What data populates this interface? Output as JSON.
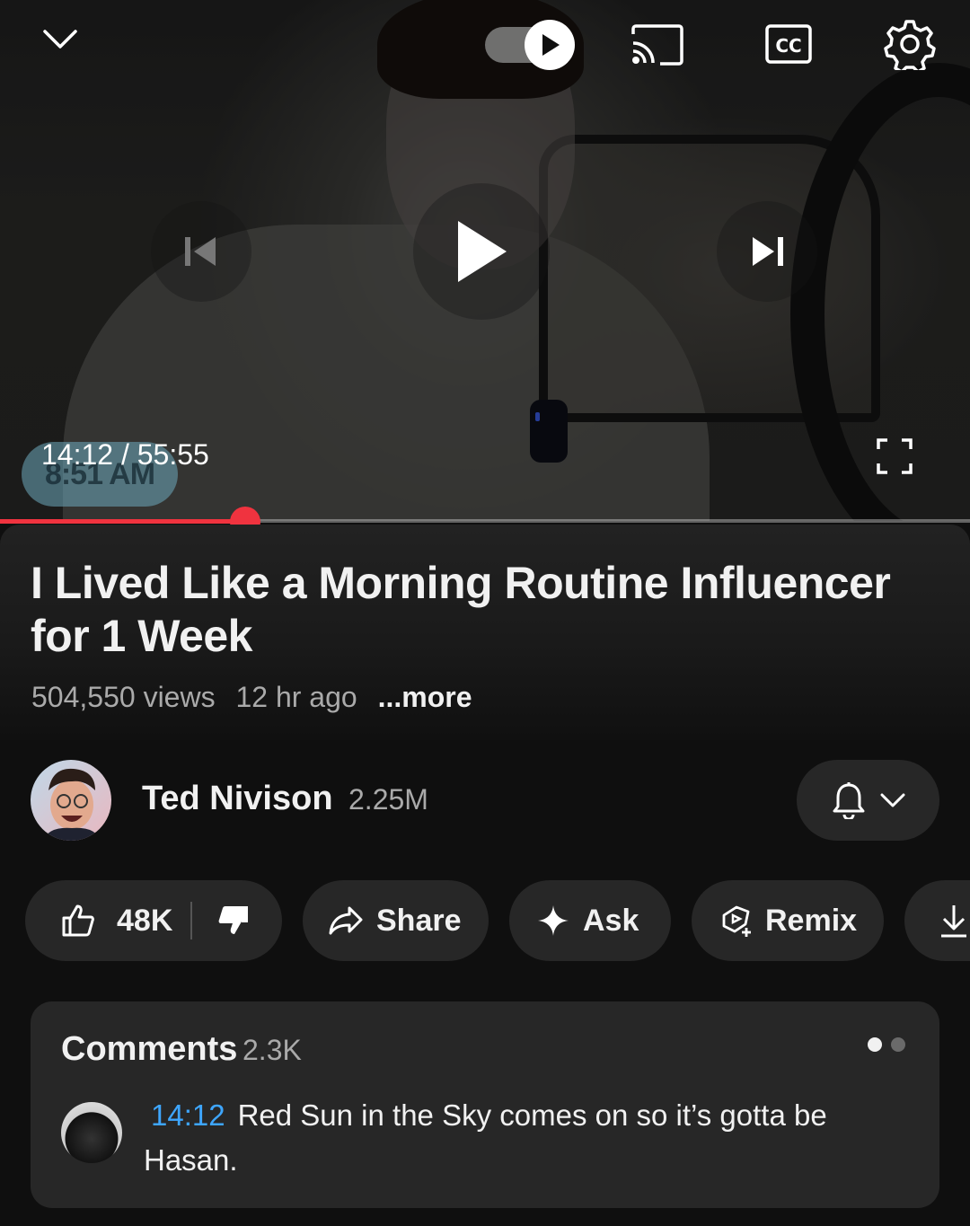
{
  "player": {
    "timestamp_overlay": "8:51 AM",
    "current_time": "14:12",
    "duration": "55:55",
    "time_separator": " / ",
    "progress": 0.253,
    "autoplay_on": true,
    "icons": [
      "chevron-down-icon",
      "autoplay-toggle",
      "cast-icon",
      "cc-icon",
      "settings-icon",
      "previous-icon",
      "play-icon",
      "next-icon",
      "fullscreen-icon"
    ]
  },
  "video": {
    "title": "I Lived Like a Morning Routine Influencer for 1 Week",
    "views": "504,550 views",
    "age": "12 hr ago",
    "more": "...more"
  },
  "channel": {
    "name": "Ted Nivison",
    "subscribers": "2.25M"
  },
  "actions": {
    "likes": "48K",
    "share": "Share",
    "ask": "Ask",
    "remix": "Remix"
  },
  "comments": {
    "heading": "Comments",
    "count": "2.3K",
    "top_comment": {
      "timestamp": "14:12",
      "text": "Red Sun in the Sky comes on so it’s gotta be Hasan."
    }
  },
  "colors": {
    "background": "#0f0f0f",
    "pill": "#272727",
    "progress": "#f0333f",
    "link": "#3ea6ff",
    "secondary_text": "#aaaaaa"
  }
}
